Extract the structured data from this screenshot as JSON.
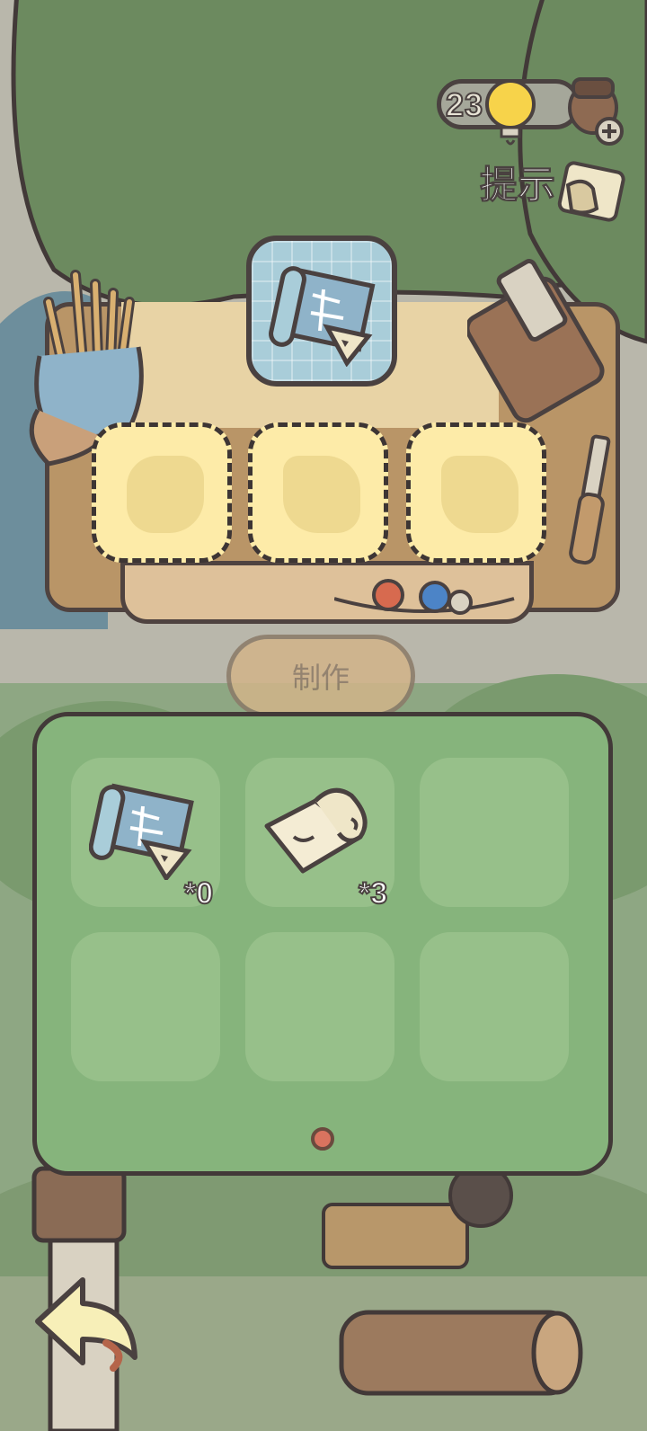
{
  "hud": {
    "coins": "23",
    "hint_label": "提示"
  },
  "workbench": {
    "recipe_item": "blueprint-scroll",
    "material_slots": 3
  },
  "make_button": {
    "label": "制作",
    "enabled": false
  },
  "inventory": {
    "items": [
      {
        "icon": "blueprint-scroll-icon",
        "count": "*0"
      },
      {
        "icon": "paper-roll-icon",
        "count": "*3"
      },
      {
        "icon": "",
        "count": ""
      },
      {
        "icon": "",
        "count": ""
      },
      {
        "icon": "",
        "count": ""
      },
      {
        "icon": "",
        "count": ""
      }
    ],
    "page_indicator_color": "#d9735f"
  },
  "colors": {
    "panel_green": "#86b47c",
    "slot_yellow": "#fdeba8",
    "outline": "#423938",
    "recipe_blue": "#a9cdd9"
  }
}
